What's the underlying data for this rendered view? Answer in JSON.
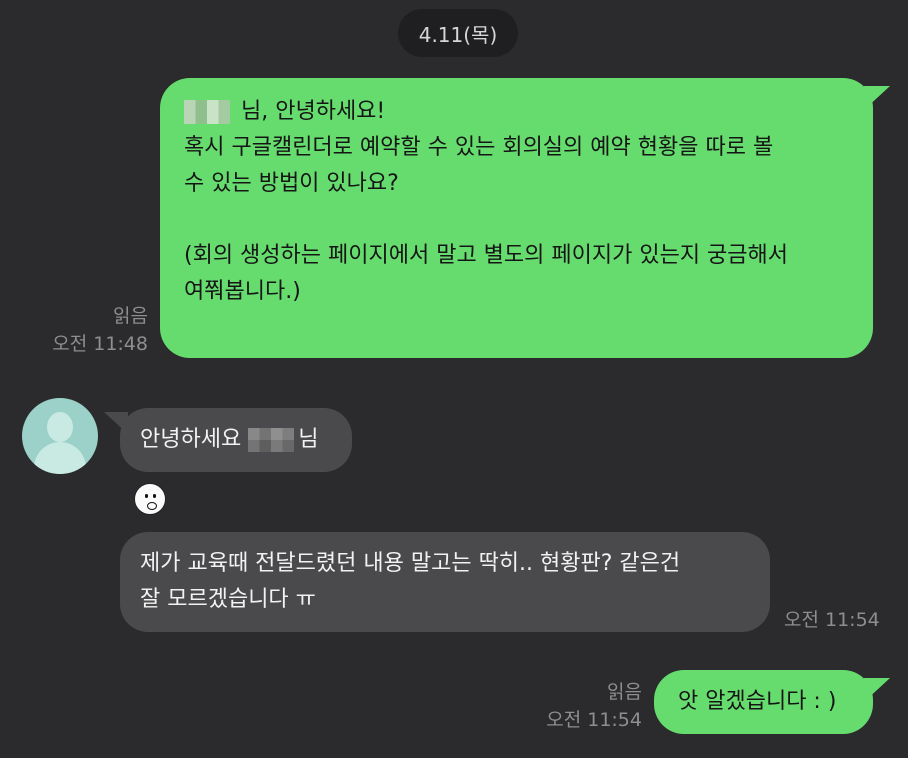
{
  "date_separator": "4.11(목)",
  "messages": [
    {
      "side": "me",
      "line1_suffix": " 님, 안녕하세요!",
      "body": "\n혹시 구글캘린더로 예약할 수 있는 회의실의 예약 현황을 따로 볼\n수 있는 방법이 있나요?\n\n(회의 생성하는 페이지에서 말고 별도의 페이지가 있는지 궁금해서\n여쭤봅니다.)",
      "read_label": "읽음",
      "time": "오전 11:48"
    },
    {
      "side": "them",
      "prefix": "안녕하세요 ",
      "suffix": "님"
    },
    {
      "side": "them",
      "text": "제가 교육때 전달드렸던 내용 말고는 딱히.. 현황판? 같은건\n잘 모르겠습니다 ㅠ",
      "time": "오전 11:54"
    },
    {
      "side": "me",
      "text": "앗 알겠습니다 : )",
      "read_label": "읽음",
      "time": "오전 11:54"
    }
  ],
  "icons": {
    "avatar": "default-profile-avatar",
    "sticker": "character-sticker-icon"
  },
  "colors": {
    "background": "#2b2b2d",
    "my_bubble": "#66dc6f",
    "their_bubble": "#4a4a4c",
    "date_pill": "#1f1f21"
  }
}
